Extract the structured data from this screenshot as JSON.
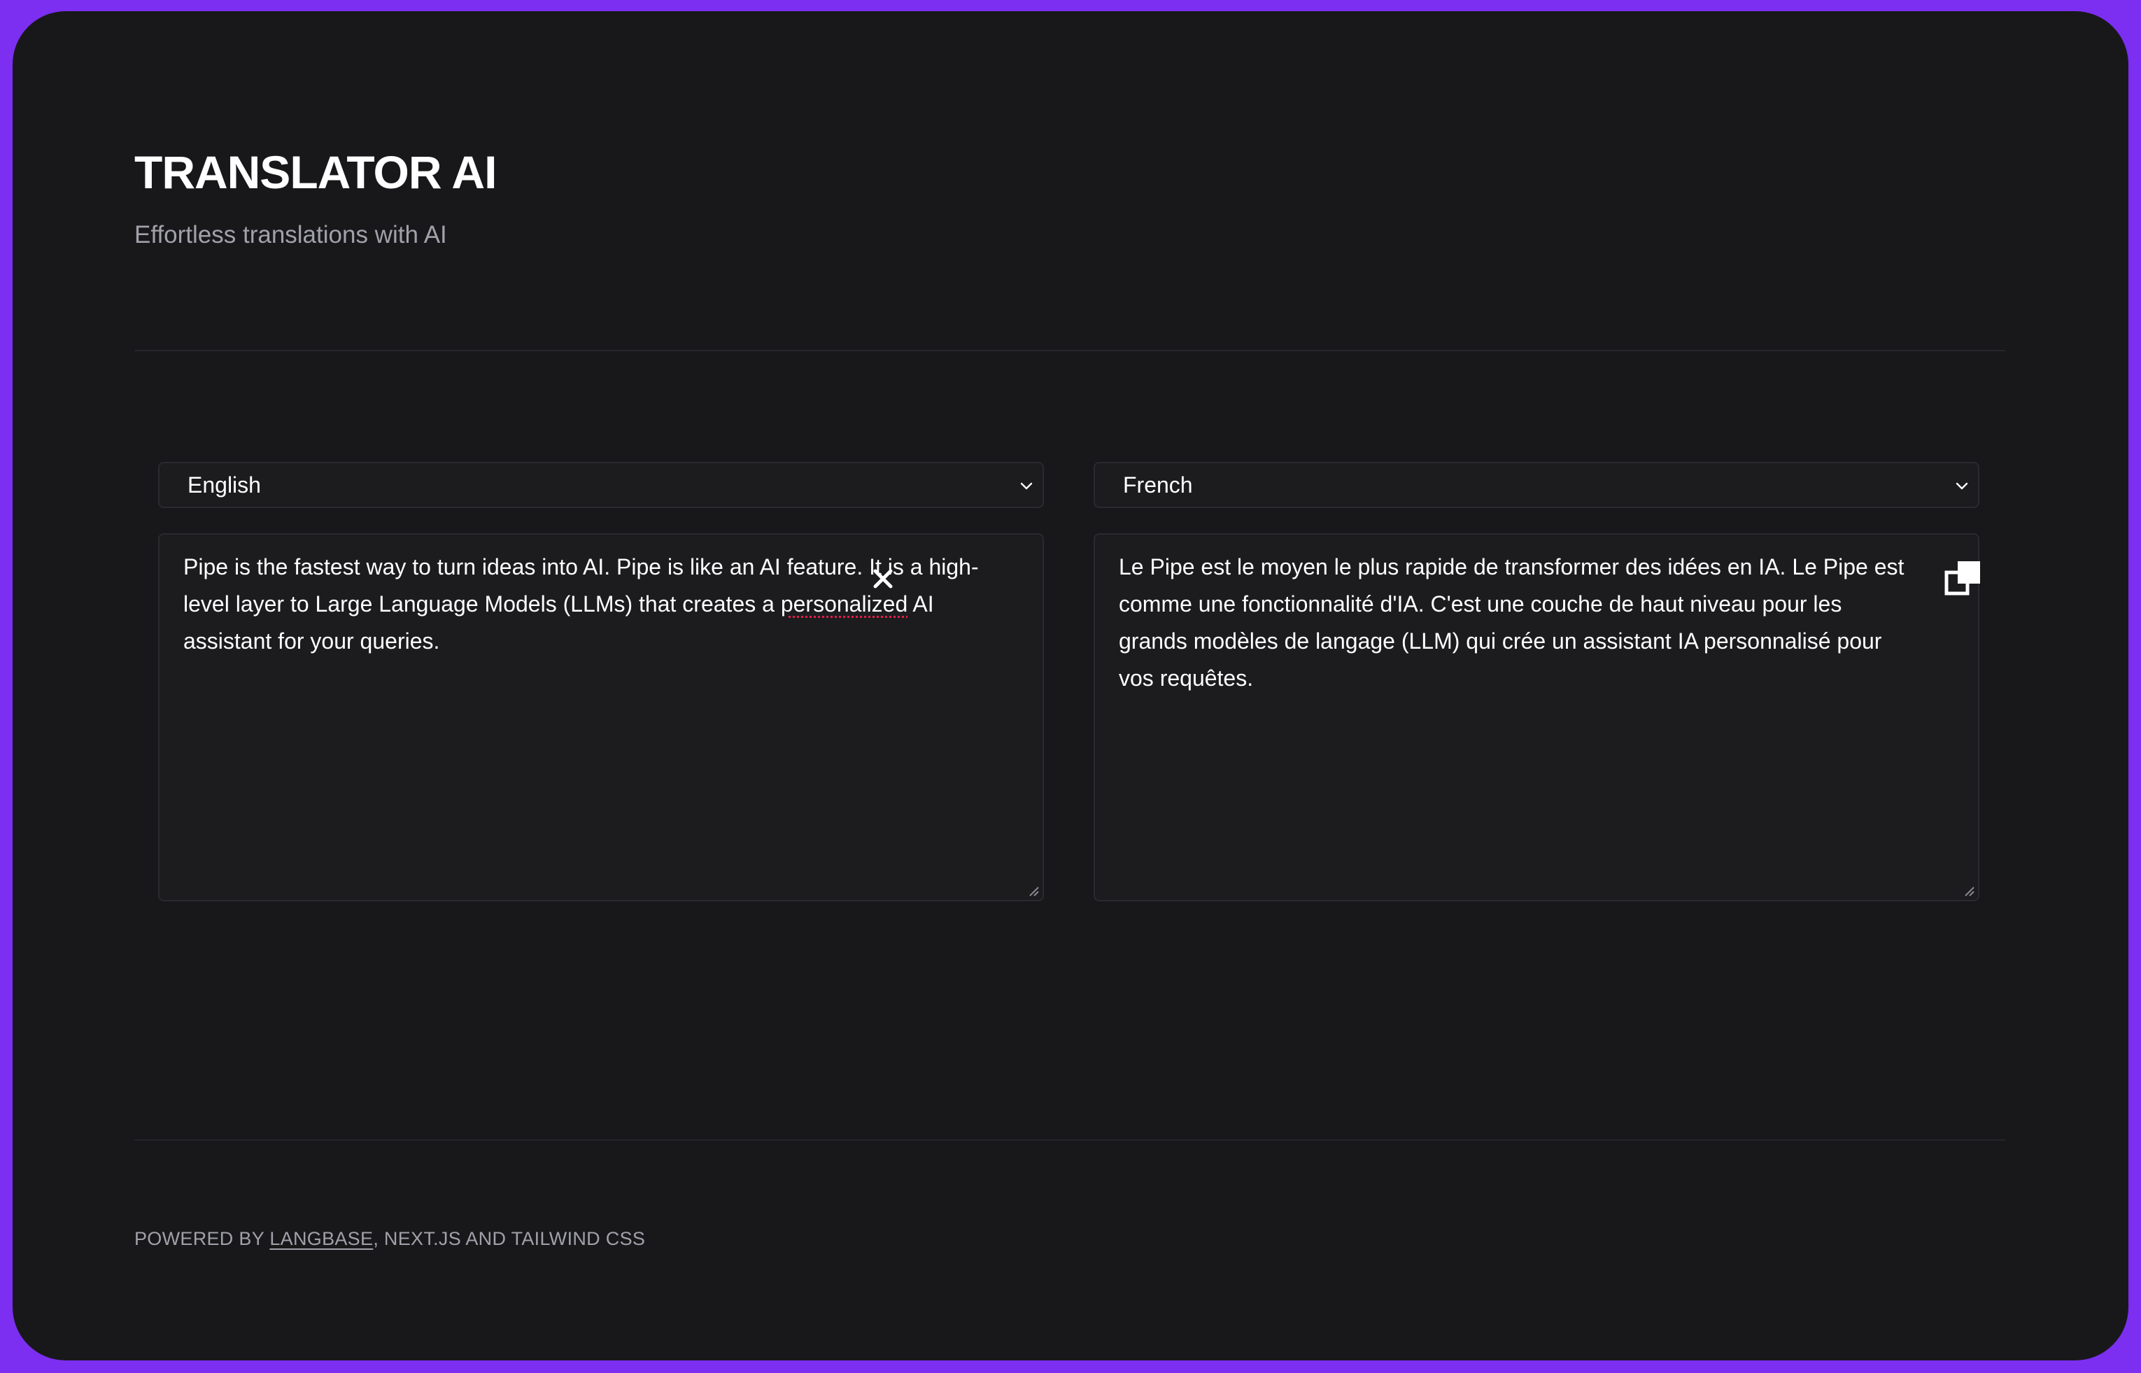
{
  "header": {
    "title": "TRANSLATOR AI",
    "subtitle": "Effortless translations with AI"
  },
  "source": {
    "language": "English",
    "text_before": "Pipe is the fastest way to turn ideas into AI. Pipe is like an AI feature. It is a high-level layer to Large Language Models (LLMs) that creates a ",
    "text_misspelled": "personalized",
    "text_after": " AI assistant for your queries.",
    "clear_icon": "close-icon"
  },
  "target": {
    "language": "French",
    "text": "Le Pipe est le moyen le plus rapide de transformer des idées en IA. Le Pipe est comme une fonctionnalité d'IA. C'est une couche de haut niveau pour les grands modèles de langage (LLM) qui crée un assistant IA personnalisé pour vos requêtes.",
    "copy_icon": "copy-icon"
  },
  "footer": {
    "prefix": "POWERED BY ",
    "link_label": "LANGBASE",
    "suffix": ", NEXT.JS AND TAILWIND CSS"
  },
  "colors": {
    "frame": "#7c2ff0",
    "background": "#18181b",
    "panel": "#1c1c1f",
    "border": "#2a2a2f",
    "muted_text": "#a1a1aa",
    "text": "#ffffff",
    "spellcheck": "#e11d48"
  }
}
